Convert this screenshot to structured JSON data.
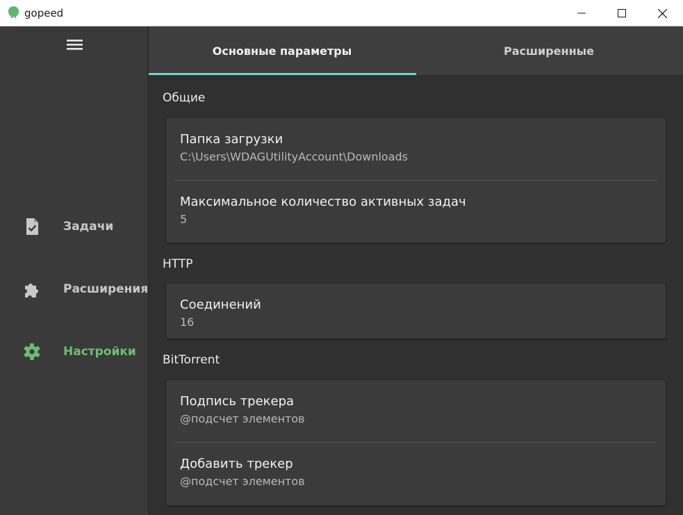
{
  "window": {
    "title": "gopeed",
    "brand_color": "#5fb66f"
  },
  "sidebar": {
    "items": [
      {
        "label": "Задачи",
        "icon": "task-check-icon",
        "active": false
      },
      {
        "label": "Расширения",
        "icon": "puzzle-icon",
        "active": false
      },
      {
        "label": "Настройки",
        "icon": "gear-icon",
        "active": true
      }
    ],
    "active_color": "#6ebd74"
  },
  "tabs": [
    {
      "label": "Основные параметры",
      "selected": true
    },
    {
      "label": "Расширенные",
      "selected": false
    }
  ],
  "tab_indicator_color": "#6fd8c8",
  "sections": {
    "general": {
      "title": "Общие",
      "rows": [
        {
          "title": "Папка загрузки",
          "value": "C:\\Users\\WDAGUtilityAccount\\Downloads"
        },
        {
          "title": "Максимальное количество активных задач",
          "value": "5"
        }
      ]
    },
    "http": {
      "title": "HTTP",
      "rows": [
        {
          "title": "Соединений",
          "value": "16"
        }
      ]
    },
    "bittorrent": {
      "title": "BitTorrent",
      "rows": [
        {
          "title": "Подпись трекера",
          "value": "@подсчет элементов"
        },
        {
          "title": "Добавить трекер",
          "value": "@подсчет элементов"
        }
      ]
    }
  }
}
